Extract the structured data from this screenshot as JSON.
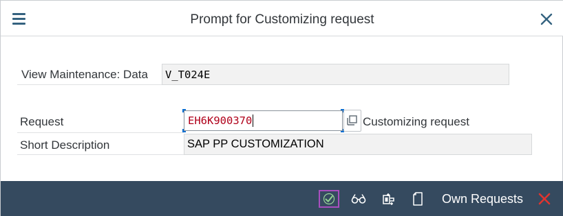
{
  "header": {
    "title": "Prompt for Customizing request",
    "menu_icon": "hamburger-menu-icon",
    "close_icon": "close-x-icon"
  },
  "form": {
    "view_label": "View Maintenance: Data",
    "view_value": "V_T024E",
    "request_label": "Request",
    "request_value": "EH6K900370",
    "request_type_text": "Customizing request",
    "short_desc_label": "Short Description",
    "short_desc_value": "SAP PP CUSTOMIZATION"
  },
  "footer": {
    "own_requests_label": "Own Requests",
    "icons": [
      "check-icon",
      "glasses-display-icon",
      "create-request-icon",
      "document-icon",
      "cancel-x-icon"
    ]
  },
  "colors": {
    "footer_bg": "#354a5f",
    "accent": "#34627f",
    "request_text": "#b0001a",
    "ok_highlight": "#a94fbf",
    "cancel_red": "#e0342f"
  }
}
